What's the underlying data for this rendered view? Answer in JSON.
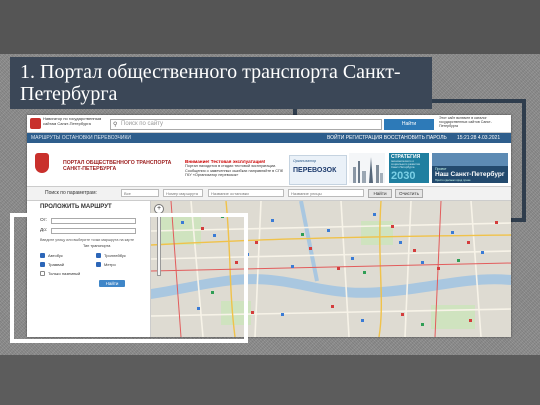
{
  "slide": {
    "title": "1. Портал общественного транспорта Санкт-Петербурга"
  },
  "gov_header": {
    "logo_text": "Навигатор по государственным сайтам Санкт-Петербурга",
    "search_placeholder": "Поиск по сайту",
    "search_button": "Найти",
    "right_text": "Этот сайт включен в каталог государственных сайтов Санкт-Петербурга"
  },
  "nav": {
    "left_items": "МАРШРУТЫ  ОСТАНОВКИ  ПЕРЕВОЗЧИКИ",
    "right_items": "ВОЙТИ  РЕГИСТРАЦИЯ  ВОССТАНОВИТЬ ПАРОЛЬ",
    "datetime": "15:21:28 4.03.2021"
  },
  "banner": {
    "portal_title": "ПОРТАЛ ОБЩЕСТВЕННОГО ТРАНСПОРТА САНКТ-ПЕТЕРБУРГА",
    "warning_title": "Внимание! Тестовая эксплуатация!",
    "warning_text": "Портал находится в стадии тестовой эксплуатации. Сообщения о замеченных ошибках направляйте в СПб ГКУ «Организатор перевозок»",
    "organizer_small": "Организатор",
    "organizer_big": "ПЕРЕВОЗОК",
    "strategy_title": "СТРАТЕГИЯ",
    "strategy_subtitle": "экономического и социального развития Санкт-Петербурга",
    "strategy_year": "2030",
    "nsp_small": "Проект",
    "nsp_title": "Наш Санкт-Петербург",
    "nsp_sub": "Просто сделаем город лучше"
  },
  "search_row": {
    "label": "Поиск по параметрам:",
    "type_value": "Все",
    "route_placeholder": "Номер маршрута",
    "stop_placeholder": "Название остановки",
    "street_placeholder": "Название улицы",
    "find_button": "Найти",
    "clear_button": "Очистить"
  },
  "route_panel": {
    "title": "ПРОЛОЖИТЬ МАРШРУТ",
    "from_label": "От:",
    "to_label": "До:",
    "hint": "Введите улицу или выберите точки маршрута на карте",
    "transport_types_label": "Тип транспорта",
    "checkbox_bus": "Автобус",
    "checkbox_tram": "Трамвай",
    "checkbox_trolley": "Троллейбус",
    "checkbox_metro": "Метро",
    "checkbox_ground_only": "Только наземный",
    "submit": "Найти"
  },
  "map": {
    "zoom_in": "+"
  },
  "colors": {
    "title_bg": "#3b4757",
    "frame_dark": "#2f3d4d",
    "nav_bg": "#2e5e8c",
    "accent_red": "#c9302c",
    "route_button": "#3f86c8"
  }
}
